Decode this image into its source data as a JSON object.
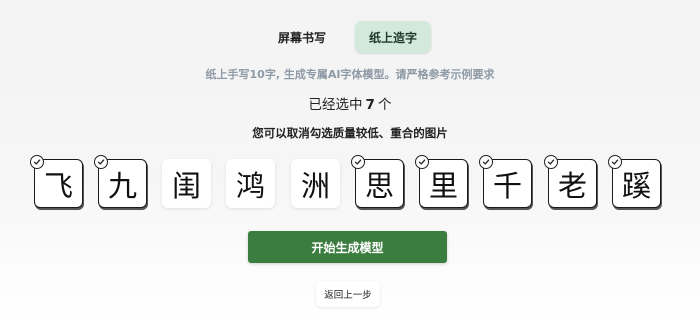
{
  "tabs": [
    {
      "label": "屏幕书写",
      "active": false
    },
    {
      "label": "纸上造字",
      "active": true
    }
  ],
  "subtitle": "纸上手写10字, 生成专属AI字体模型。请严格参考示例要求",
  "selection": {
    "prefix": "已经选中",
    "count": "7",
    "suffix": "个"
  },
  "hint": "您可以取消勾选质量较低、重合的图片",
  "characters": [
    {
      "glyph": "飞",
      "selected": true
    },
    {
      "glyph": "九",
      "selected": true
    },
    {
      "glyph": "闺",
      "selected": false
    },
    {
      "glyph": "鸿",
      "selected": false
    },
    {
      "glyph": "洲",
      "selected": false
    },
    {
      "glyph": "思",
      "selected": true
    },
    {
      "glyph": "里",
      "selected": true
    },
    {
      "glyph": "千",
      "selected": true
    },
    {
      "glyph": "老",
      "selected": true
    },
    {
      "glyph": "蹊",
      "selected": true
    }
  ],
  "primary_button": "开始生成模型",
  "back_button": "返回上一步",
  "colors": {
    "accent": "#3b7d3f",
    "tab_active_bg": "#d3e9dc",
    "subtitle": "#8e9aa6"
  },
  "icons": {
    "selected_marker": "check-circle-icon"
  }
}
